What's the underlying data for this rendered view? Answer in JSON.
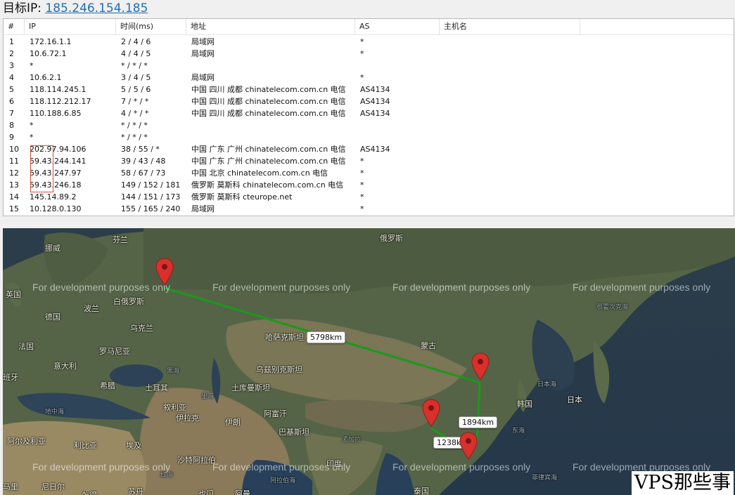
{
  "target": {
    "label": "目标IP:",
    "ip": "185.246.154.185"
  },
  "table": {
    "headers": {
      "num": "#",
      "ip": "IP",
      "time": "时间(ms)",
      "addr": "地址",
      "as": "AS",
      "host": "主机名"
    },
    "rows": [
      {
        "num": "1",
        "ip": "172.16.1.1",
        "time": "2 / 4 / 6",
        "addr": "局域网",
        "as": "*"
      },
      {
        "num": "2",
        "ip": "10.6.72.1",
        "time": "4 / 4 / 5",
        "addr": "局域网",
        "as": "*"
      },
      {
        "num": "3",
        "ip": "*",
        "time": "* / * / *",
        "addr": "",
        "as": ""
      },
      {
        "num": "4",
        "ip": "10.6.2.1",
        "time": "3 / 4 / 5",
        "addr": "局域网",
        "as": "*"
      },
      {
        "num": "5",
        "ip": "118.114.245.1",
        "time": "5 / 5 / 6",
        "addr": "中国 四川 成都 chinatelecom.com.cn 电信",
        "as": "AS4134"
      },
      {
        "num": "6",
        "ip": "118.112.212.17",
        "time": "7 / * / *",
        "addr": "中国 四川 成都 chinatelecom.com.cn 电信",
        "as": "AS4134"
      },
      {
        "num": "7",
        "ip": "110.188.6.85",
        "time": "4 / * / *",
        "addr": "中国 四川 成都 chinatelecom.com.cn 电信",
        "as": "AS4134"
      },
      {
        "num": "8",
        "ip": "*",
        "time": "* / * / *",
        "addr": "",
        "as": ""
      },
      {
        "num": "9",
        "ip": "*",
        "time": "* / * / *",
        "addr": "",
        "as": ""
      },
      {
        "num": "10",
        "ip": "202.97.94.106",
        "time": "38 / 55 / *",
        "addr": "中国 广东 广州 chinatelecom.com.cn 电信",
        "as": "AS4134"
      },
      {
        "num": "11",
        "ip": "59.43.244.141",
        "time": "39 / 43 / 48",
        "addr": "中国 广东 广州 chinatelecom.com.cn 电信",
        "as": "*"
      },
      {
        "num": "12",
        "ip": "59.43.247.97",
        "time": "58 / 67 / 73",
        "addr": "中国 北京 chinatelecom.com.cn 电信",
        "as": "*"
      },
      {
        "num": "13",
        "ip": "59.43.246.18",
        "time": "149 / 152 / 181",
        "addr": "俄罗斯 莫斯科 chinatelecom.com.cn 电信",
        "as": "*"
      },
      {
        "num": "14",
        "ip": "145.14.89.2",
        "time": "144 / 151 / 173",
        "addr": "俄罗斯 莫斯科 cteurope.net",
        "as": "*"
      },
      {
        "num": "15",
        "ip": "10.128.0.130",
        "time": "155 / 165 / 240",
        "addr": "局域网",
        "as": "*"
      }
    ]
  },
  "map": {
    "watermark": "For development purposes only",
    "distances": [
      "5798km",
      "1894km",
      "1238km"
    ],
    "labels": {
      "finland": "芬兰",
      "russia": "俄罗斯",
      "norway": "挪威",
      "uk": "英国",
      "belarus": "白俄罗斯",
      "poland": "波兰",
      "germany": "德国",
      "ukraine": "乌克兰",
      "france": "法国",
      "romania": "罗马尼亚",
      "kazakhstan": "哈萨克斯坦",
      "mongolia": "蒙古",
      "italy": "意大利",
      "spain": "班牙",
      "greece": "希腊",
      "turkey": "土耳其",
      "uzbekistan": "乌兹别克斯坦",
      "turkmenistan": "土库曼斯坦",
      "syria": "叙利亚",
      "iraq": "伊拉克",
      "iran": "伊朗",
      "afghanistan": "阿富汗",
      "pakistan": "巴基斯坦",
      "algeria": "阿尔及利亚",
      "libya": "利比亚",
      "egypt": "埃及",
      "saudi": "沙特阿拉伯",
      "india": "印度",
      "korea": "韩国",
      "japan": "日本",
      "japan_sea": "日本海",
      "okhotsk": "鄂霍次克海",
      "mediterranean": "地中海",
      "black_sea": "黑海",
      "caspian": "里海",
      "red_sea": "红海",
      "arabian_sea": "阿拉伯海",
      "bengal": "孟加拉",
      "philippine_sea": "菲律宾海",
      "east_china_sea": "东海",
      "niger": "尼日尔",
      "mali": "马里",
      "sudan": "苏丹",
      "chad": "乍得",
      "oman": "阿曼",
      "thailand": "泰国",
      "yemen": "也门"
    }
  },
  "brand": "VPS那些事",
  "colors": {
    "route": "#1a9a1a",
    "pin": "#d9302c",
    "link": "#1f6fb2"
  }
}
